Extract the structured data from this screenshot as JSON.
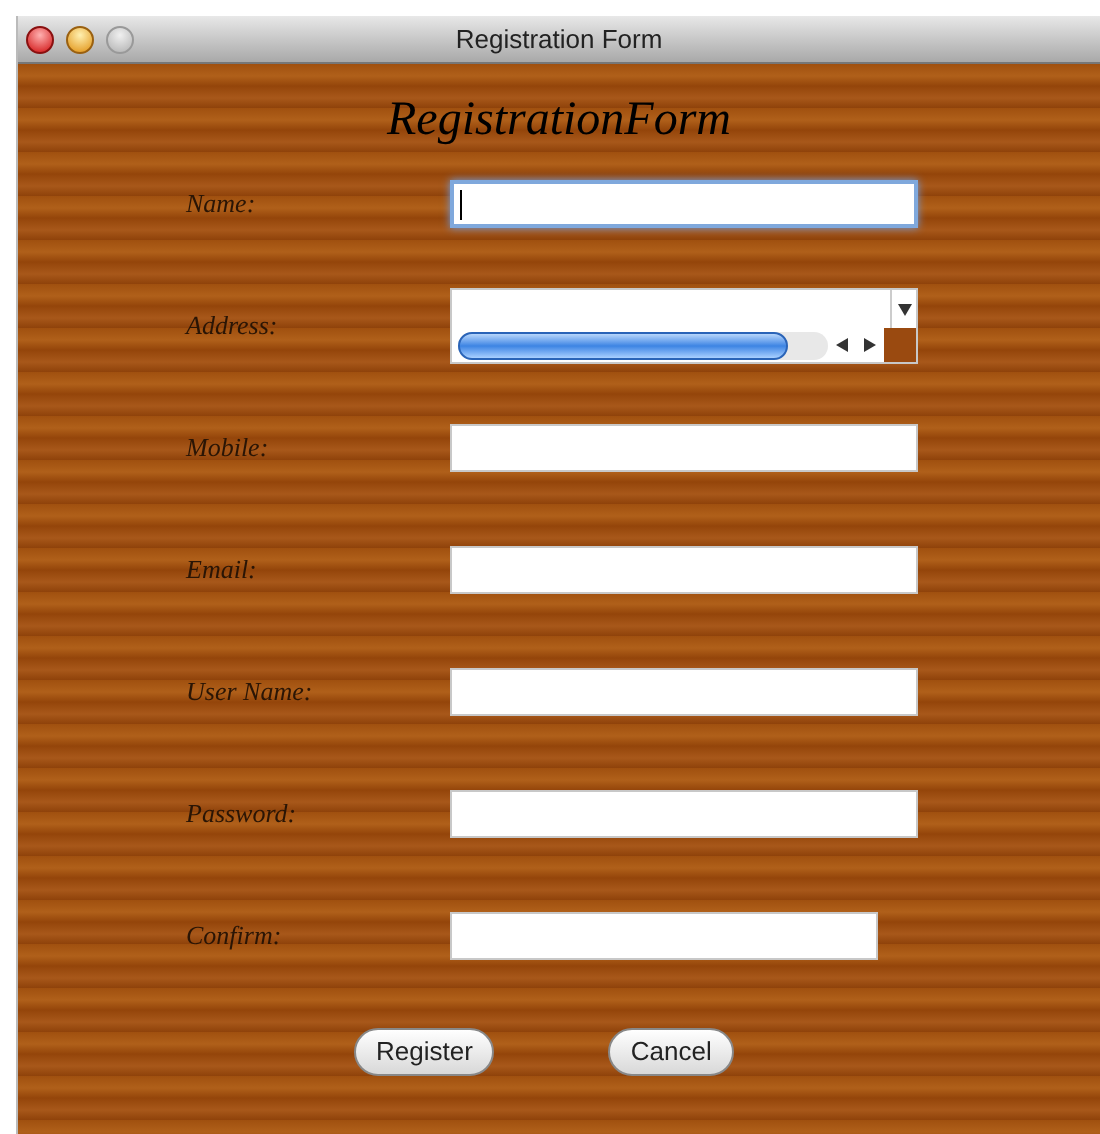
{
  "window": {
    "title": "Registration Form"
  },
  "heading": "RegistrationForm",
  "fields": [
    {
      "label": "Name:",
      "kind": "text",
      "focused": true
    },
    {
      "label": "Address:",
      "kind": "textarea",
      "focused": false
    },
    {
      "label": "Mobile:",
      "kind": "text",
      "focused": false
    },
    {
      "label": "Email:",
      "kind": "text",
      "focused": false
    },
    {
      "label": "User Name:",
      "kind": "text",
      "focused": false
    },
    {
      "label": "Password:",
      "kind": "text",
      "focused": false
    },
    {
      "label": "Confirm:",
      "kind": "short",
      "focused": false
    }
  ],
  "buttons": [
    "Register",
    "Cancel"
  ]
}
